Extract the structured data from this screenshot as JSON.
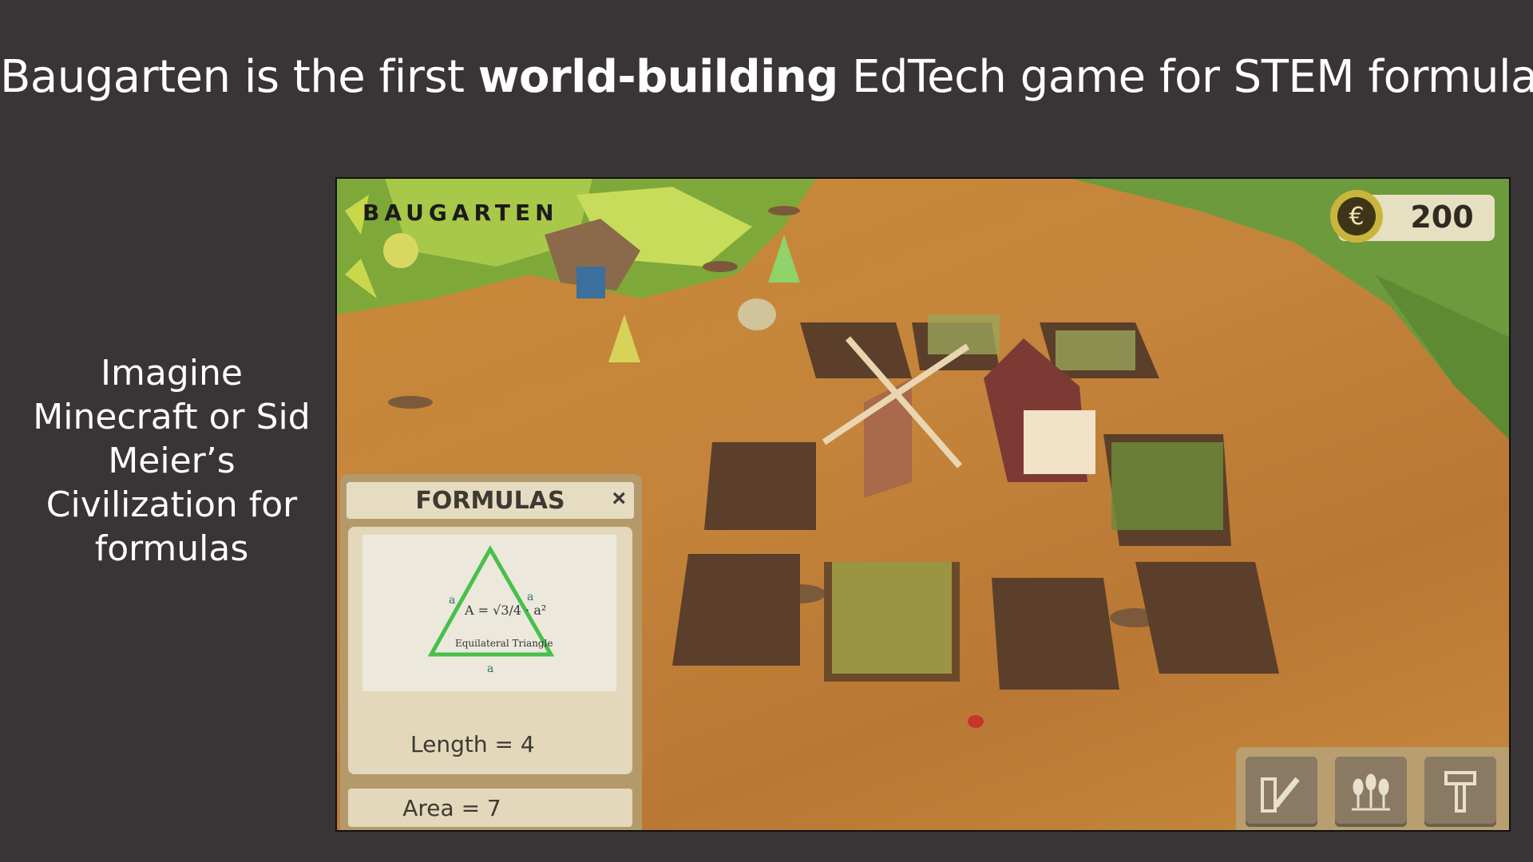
{
  "headline": {
    "before": "Baugarten is the first ",
    "bold": "world-building",
    "after": " EdTech game for STEM formulas"
  },
  "side_text": [
    "Imagine",
    "Minecraft or Sid",
    "Meier’s",
    "Civilization for",
    "formulas"
  ],
  "game": {
    "logo": "BAUGARTEN",
    "coins": {
      "icon": "euro-coin-icon",
      "symbol": "€",
      "value": "200"
    },
    "formulas_panel": {
      "title": "FORMULAS",
      "close_symbol": "×",
      "card": {
        "shape": "Equilateral Triangle",
        "formula": "A = √3/4 · a²",
        "side_label": "a"
      },
      "length_label": "Length = 4",
      "area_label": "Area = 7"
    },
    "toolbar": {
      "buttons": [
        {
          "name": "edit-button",
          "icon": "pencil-ruler-icon"
        },
        {
          "name": "crops-button",
          "icon": "wheat-icon"
        },
        {
          "name": "build-button",
          "icon": "hammer-icon"
        }
      ]
    }
  }
}
